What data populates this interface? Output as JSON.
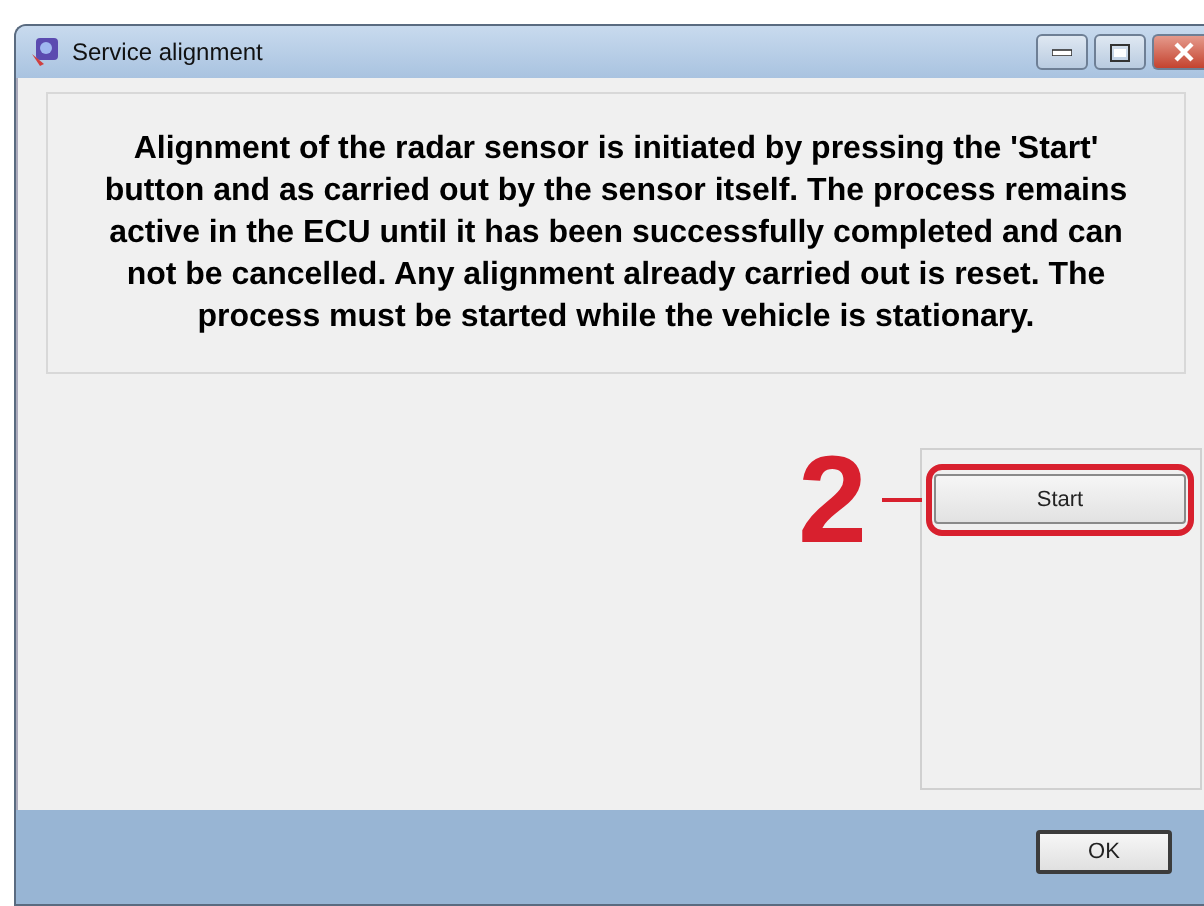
{
  "window": {
    "title": "Service alignment"
  },
  "message": "Alignment of the radar sensor is initiated by pressing the 'Start' button and as carried out by the sensor itself. The process remains active in the ECU until it has been successfully completed and can not be cancelled.  Any alignment already carried out is reset. The process must be started while the vehicle is stationary.",
  "start_button": {
    "label": "Start"
  },
  "callout": {
    "label": "2"
  },
  "ok_button": {
    "label": "OK"
  }
}
